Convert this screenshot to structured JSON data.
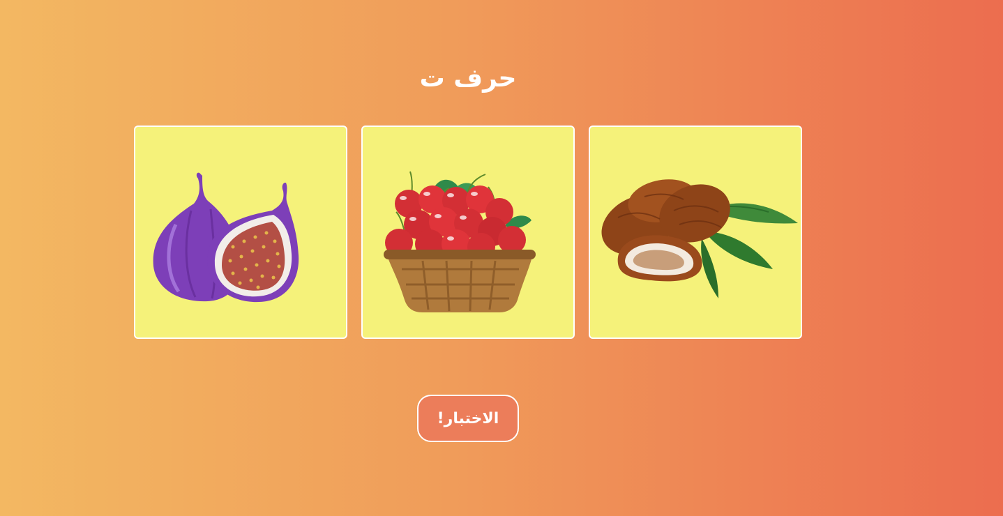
{
  "page": {
    "title": "حرف ت",
    "background_from": "#f3b862",
    "background_to": "#ec6d4f"
  },
  "cards": [
    {
      "icon": "fig-icon",
      "background": "#f5f27a"
    },
    {
      "icon": "cherry-basket-icon",
      "background": "#f5f27a"
    },
    {
      "icon": "dates-icon",
      "background": "#f5f27a"
    }
  ],
  "actions": {
    "test_label": "الاختبار!"
  }
}
